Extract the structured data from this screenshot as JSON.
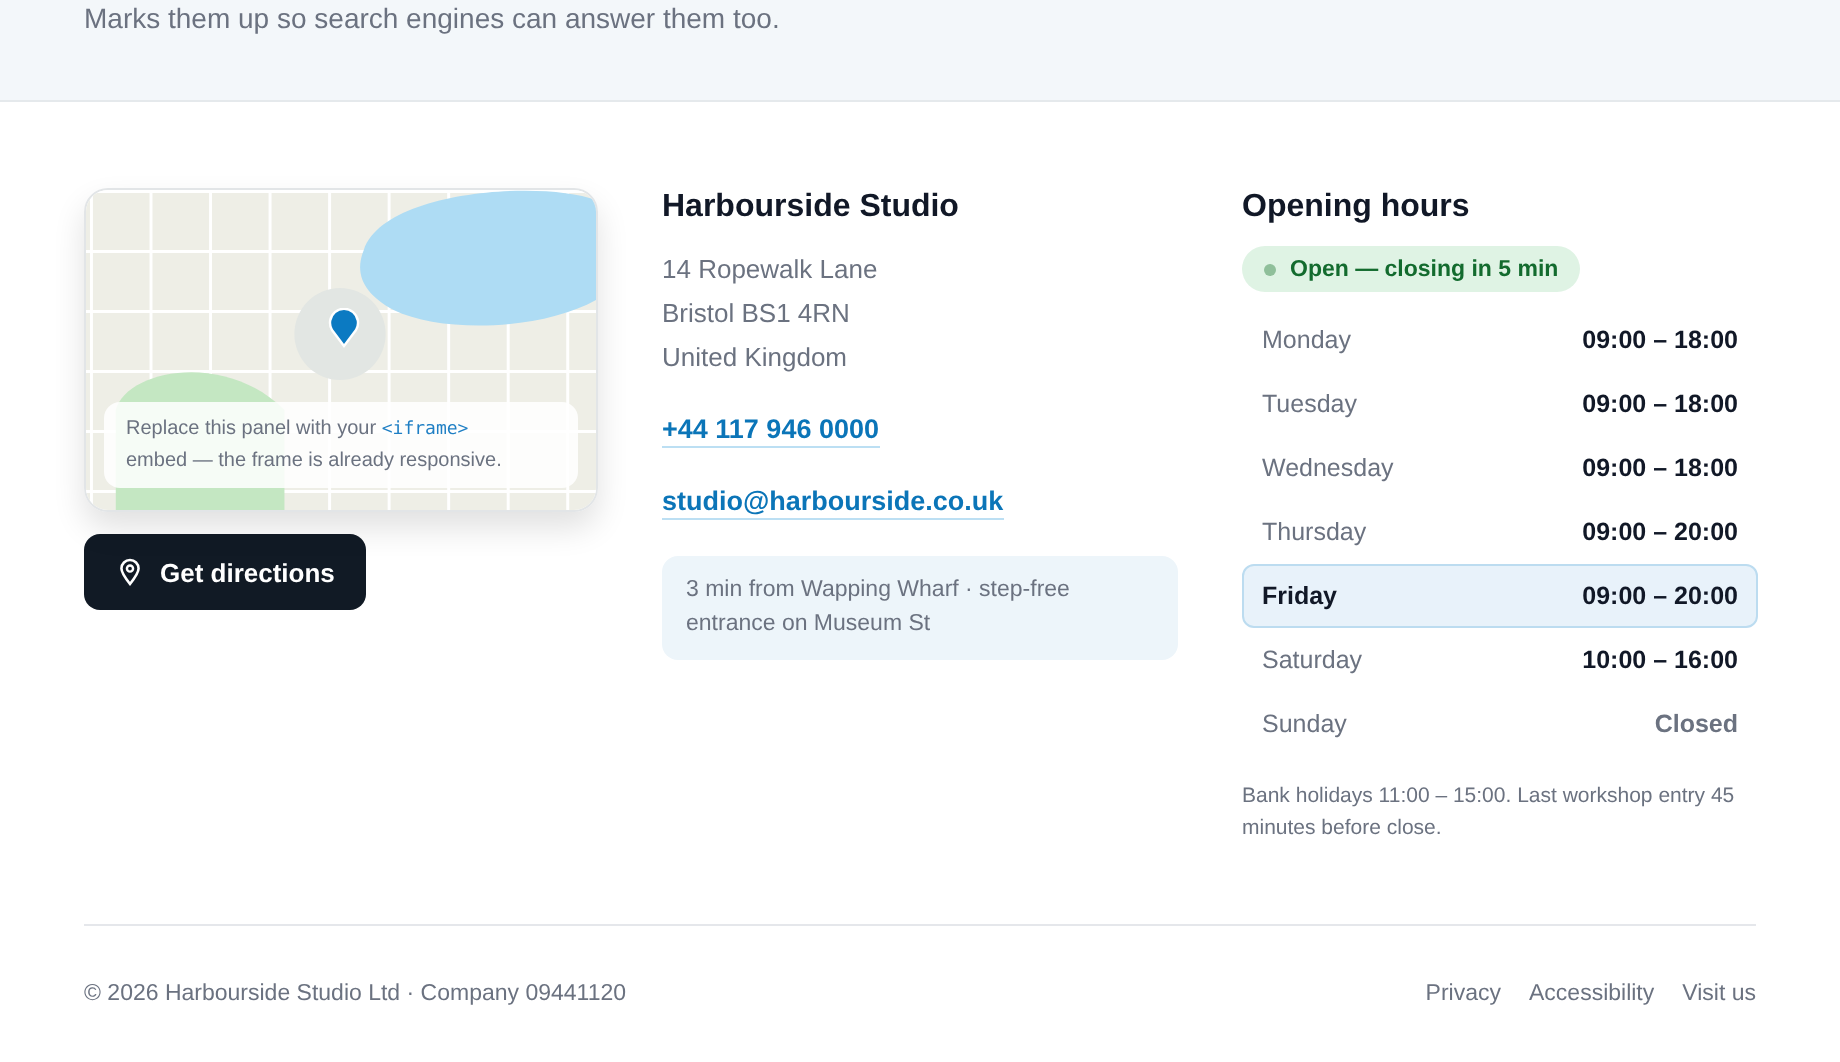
{
  "intro": {
    "text": "Marks them up so search engines can answer them too."
  },
  "map": {
    "note_parts": [
      "Replace this panel with your ",
      "<iframe>",
      " embed — the frame is already responsive."
    ]
  },
  "directions_button": {
    "label": "Get directions"
  },
  "contact": {
    "name": "Harbourside Studio",
    "address": [
      "14 Ropewalk Lane",
      "Bristol BS1 4RN",
      "United Kingdom"
    ],
    "phone": "+44 117 946 0000",
    "email": "studio@harbourside.co.uk",
    "transit_note": "3 min from Wapping Wharf · step-free entrance on Museum St"
  },
  "hours": {
    "title": "Opening hours",
    "status": {
      "label": "Open — closing in 5 min",
      "color": "#8fbf9a"
    },
    "days": [
      {
        "day": "Monday",
        "hours": "09:00 – 18:00",
        "selected": false,
        "closed": false
      },
      {
        "day": "Tuesday",
        "hours": "09:00 – 18:00",
        "selected": false,
        "closed": false
      },
      {
        "day": "Wednesday",
        "hours": "09:00 – 18:00",
        "selected": false,
        "closed": false
      },
      {
        "day": "Thursday",
        "hours": "09:00 – 20:00",
        "selected": false,
        "closed": false
      },
      {
        "day": "Friday",
        "hours": "09:00 – 20:00",
        "selected": true,
        "closed": false
      },
      {
        "day": "Saturday",
        "hours": "10:00 – 16:00",
        "selected": false,
        "closed": false
      },
      {
        "day": "Sunday",
        "hours": "Closed",
        "selected": false,
        "closed": true
      }
    ],
    "note": "Bank holidays 11:00 – 15:00. Last workshop entry 45 minutes before close."
  },
  "footer": {
    "copyright": "© 2026 Harbourside Studio Ltd · Company 09441120",
    "links": [
      "Privacy",
      "Accessibility",
      "Visit us"
    ]
  }
}
